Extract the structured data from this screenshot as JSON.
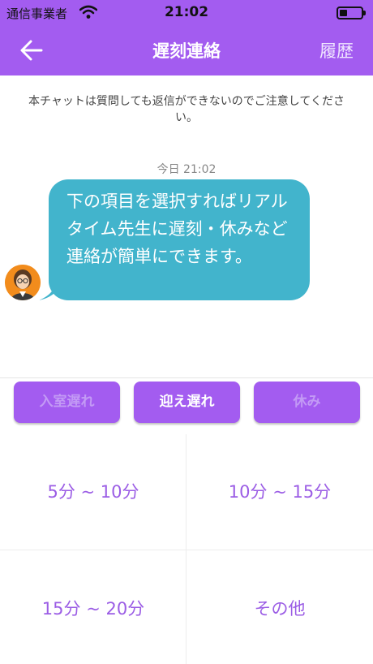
{
  "status_bar": {
    "carrier": "通信事業者",
    "time": "21:02",
    "battery_level": 0.35
  },
  "nav": {
    "title": "遅刻連絡",
    "history_label": "履歴"
  },
  "notice": "本チャットは質問しても返信ができないのでご注意してください。",
  "chat": {
    "timestamp": "今日 21:02",
    "message": "下の項目を選択すればリアルタイム先生に遅刻・休みなど連絡が簡単にできます。"
  },
  "tabs": [
    {
      "label": "入室遅れ",
      "state": "inactive"
    },
    {
      "label": "迎え遅れ",
      "state": "active"
    },
    {
      "label": "休み",
      "state": "inactive"
    }
  ],
  "options": [
    "5分 ~ 10分",
    "10分 ~ 15分",
    "15分 ~ 20分",
    "その他"
  ],
  "colors": {
    "brand": "#a35cf0",
    "bubble": "#42b4cc",
    "option_text": "#9b5de5"
  }
}
